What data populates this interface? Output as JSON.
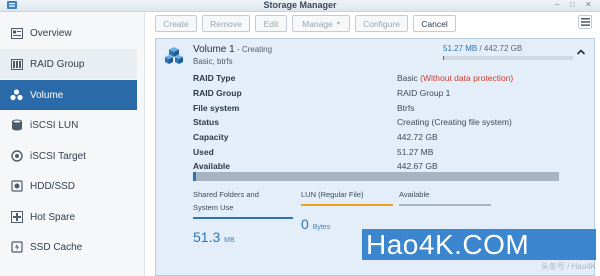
{
  "window": {
    "title": "Storage Manager"
  },
  "sidebar": {
    "items": [
      {
        "label": "Overview",
        "icon": "overview-icon"
      },
      {
        "label": "RAID Group",
        "icon": "raid-group-icon"
      },
      {
        "label": "Volume",
        "icon": "volume-icon",
        "active": true
      },
      {
        "label": "iSCSI LUN",
        "icon": "iscsi-lun-icon"
      },
      {
        "label": "iSCSI Target",
        "icon": "iscsi-target-icon"
      },
      {
        "label": "HDD/SSD",
        "icon": "hdd-icon"
      },
      {
        "label": "Hot Spare",
        "icon": "hot-spare-icon"
      },
      {
        "label": "SSD Cache",
        "icon": "ssd-cache-icon"
      }
    ]
  },
  "toolbar": {
    "create": "Create",
    "remove": "Remove",
    "edit": "Edit",
    "manage": "Manage",
    "configure": "Configure",
    "cancel": "Cancel"
  },
  "volume": {
    "name": "Volume 1",
    "status_suffix": " - Creating",
    "subtitle": "Basic, btrfs",
    "used": "51.27 MB",
    "total": " / 442.72 GB",
    "used_fraction": 0.0001,
    "properties": [
      {
        "key": "RAID Type",
        "value": "Basic ",
        "warn": "(Without data protection)"
      },
      {
        "key": "RAID Group",
        "value": "RAID Group 1",
        "warn": ""
      },
      {
        "key": "File system",
        "value": "Btrfs",
        "warn": ""
      },
      {
        "key": "Status",
        "value": "Creating (Creating file system)",
        "warn": ""
      },
      {
        "key": "Capacity",
        "value": "442.72 GB",
        "warn": ""
      },
      {
        "key": "Used",
        "value": "51.27 MB",
        "warn": ""
      },
      {
        "key": "Available",
        "value": "442.67 GB",
        "warn": ""
      }
    ],
    "usage_bar_fraction": 0.0001,
    "stats": [
      {
        "label1": "Shared Folders and",
        "label2": "System Use",
        "value": "51.3",
        "unit": "MB",
        "color": "#2e74b5"
      },
      {
        "label1": "",
        "label2": "LUN (Regular File)",
        "value": "0",
        "unit": "Bytes",
        "color": "#f0a020"
      },
      {
        "label1": "",
        "label2": "Available",
        "value": "",
        "unit": "",
        "color": "#a7b5c3"
      }
    ]
  },
  "watermark": {
    "text": "Hao4K.COM",
    "sub": "头条号 / Hao4K"
  },
  "colors": {
    "accent": "#2e74b5",
    "active_nav": "#2a6aa8",
    "warning": "#d33b2c",
    "panel_bg": "#e3eef8"
  }
}
